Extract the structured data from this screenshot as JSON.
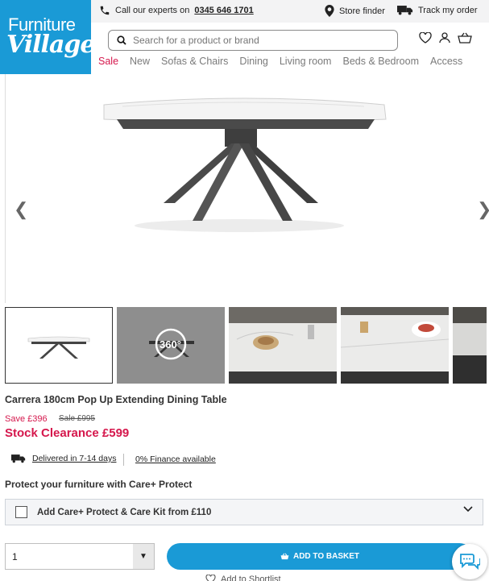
{
  "brand": {
    "line1": "Furniture",
    "line2": "Village"
  },
  "topbar": {
    "call_prefix": "Call our experts on",
    "phone": "0345 646 1701",
    "store_finder": "Store finder",
    "track_order": "Track my order"
  },
  "search": {
    "placeholder": "Search for a product or brand"
  },
  "nav": [
    "Sale",
    "New",
    "Sofas & Chairs",
    "Dining",
    "Living room",
    "Beds & Bedroom",
    "Access"
  ],
  "gallery": {
    "badge_360": "360°"
  },
  "product": {
    "title": "Carrera 180cm Pop Up Extending Dining Table",
    "save": "Save £396",
    "was": "Sale £995",
    "price": "Stock Clearance £599",
    "delivery": "Delivered in 7-14 days",
    "finance": "0% Finance available",
    "protect_heading": "Protect your furniture with Care+ Protect",
    "careplus_label": "Add Care+ Protect & Care Kit from £110"
  },
  "purchase": {
    "quantity": "1",
    "add_to_basket": "ADD TO BASKET",
    "shortlist": "Add to Shortlist"
  },
  "colors": {
    "brand_blue": "#1a9ad6",
    "sale_red": "#d5174c"
  }
}
